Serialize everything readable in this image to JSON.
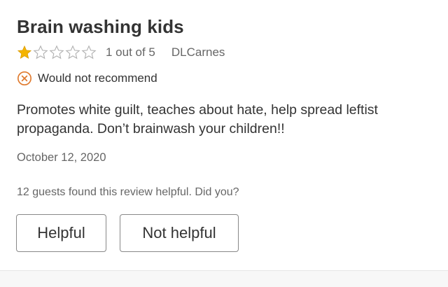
{
  "review": {
    "title": "Brain washing kids",
    "rating": {
      "value": 1,
      "max": 5,
      "text": "1 out of 5",
      "filled_color": "#f4b400",
      "empty_color": "#bdbdbd"
    },
    "author": "DLCarnes",
    "recommendation": {
      "icon": "x-circle-icon",
      "text": "Would not recommend",
      "icon_color": "#e07a2e"
    },
    "body": "Promotes white guilt, teaches about hate, help spread leftist propaganda. Don’t brainwash your children!!",
    "date": "October 12, 2020",
    "helpful_prompt": "12 guests found this review helpful. Did you?",
    "buttons": {
      "helpful": "Helpful",
      "not_helpful": "Not helpful"
    }
  }
}
